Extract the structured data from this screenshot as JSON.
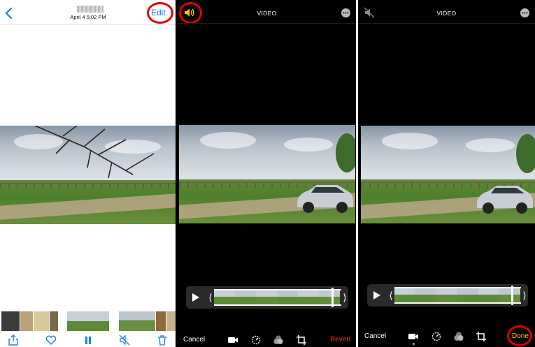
{
  "panel1": {
    "header": {
      "date": "April 4  5:02 PM",
      "edit_label": "Edit"
    },
    "icons": {
      "back": "chevron-left-icon",
      "share": "share-icon",
      "favorite": "heart-icon",
      "pause": "pause-icon",
      "mute": "speaker-muted-icon",
      "delete": "trash-icon"
    }
  },
  "panel2": {
    "title": "VIDEO",
    "cancel_label": "Cancel",
    "revert_label": "Revert",
    "icons": {
      "audio": "speaker-on-icon",
      "more": "more-icon",
      "play": "play-icon",
      "video": "video-camera-icon",
      "adjust": "adjust-dial-icon",
      "filters": "filters-icon",
      "crop": "crop-icon"
    }
  },
  "panel3": {
    "title": "VIDEO",
    "cancel_label": "Cancel",
    "done_label": "Done",
    "icons": {
      "audio": "speaker-muted-icon",
      "more": "more-icon",
      "play": "play-icon",
      "video": "video-camera-icon",
      "adjust": "adjust-dial-icon",
      "filters": "filters-icon",
      "crop": "crop-icon"
    }
  },
  "colors": {
    "ios_blue": "#1a7cf5",
    "revert_red": "#ff3b30",
    "done_yellow": "#ffcc00",
    "speaker_yellow": "#ffcc00",
    "highlight_red": "#e00000"
  }
}
